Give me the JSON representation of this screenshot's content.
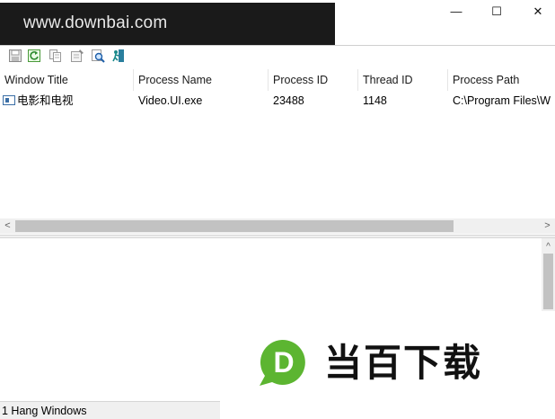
{
  "watermark": {
    "text": "www.downbai.com"
  },
  "window_controls": {
    "minimize": "—",
    "maximize": "☐",
    "close": "✕"
  },
  "toolbar": {
    "icons": [
      "save-icon",
      "refresh-icon",
      "copy-icon",
      "properties-icon",
      "find-icon",
      "exit-icon"
    ]
  },
  "list": {
    "columns": [
      "Window Title",
      "Process Name",
      "Process ID",
      "Thread ID",
      "Process Path"
    ],
    "rows": [
      {
        "window_title": "电影和电视",
        "process_name": "Video.UI.exe",
        "process_id": "23488",
        "thread_id": "1148",
        "process_path": "C:\\Program Files\\W"
      }
    ]
  },
  "scroll": {
    "left_arrow": "<",
    "right_arrow": ">",
    "up_arrow": "^"
  },
  "status": {
    "text": "1 Hang Windows"
  },
  "brand": {
    "logo_letter": "D",
    "name": "当百下载",
    "logo_color": "#5cb531"
  }
}
